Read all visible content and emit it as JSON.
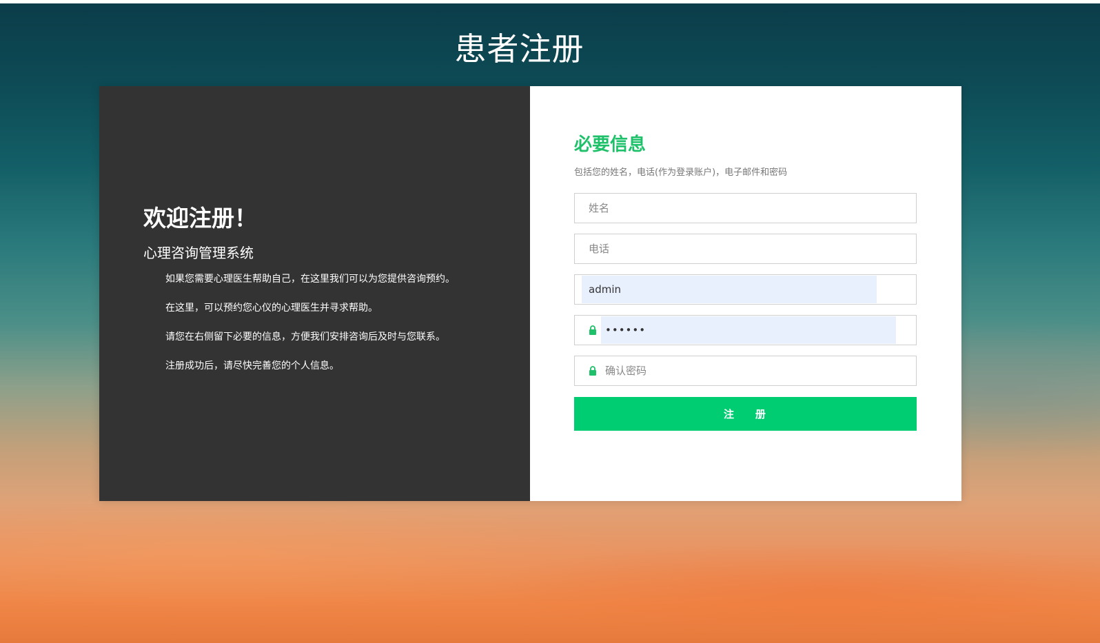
{
  "page": {
    "title": "患者注册"
  },
  "intro": {
    "title": "欢迎注册！",
    "subtitle": "心理咨询管理系统",
    "lines": [
      "如果您需要心理医生帮助自己，在这里我们可以为您提供咨询预约。",
      "在这里，可以预约您心仪的心理医生并寻求帮助。",
      "请您在右侧留下必要的信息，方便我们安排咨询后及时与您联系。",
      "注册成功后，请尽快完善您的个人信息。"
    ]
  },
  "form": {
    "title": "必要信息",
    "description": "包括您的姓名，电话(作为登录账户)，电子邮件和密码",
    "name_placeholder": "姓名",
    "phone_placeholder": "电话",
    "account_value": "admin",
    "password_display": "••••••",
    "confirm_placeholder": "确认密码",
    "submit_label": "注    册"
  },
  "colors": {
    "accent": "#00cd72",
    "heading_green": "#1fc06a",
    "left_panel_bg": "#333333",
    "autofill_bg": "#e8f0fe"
  },
  "icons": {
    "password_lock": "lock-icon",
    "confirm_lock": "lock-icon"
  }
}
